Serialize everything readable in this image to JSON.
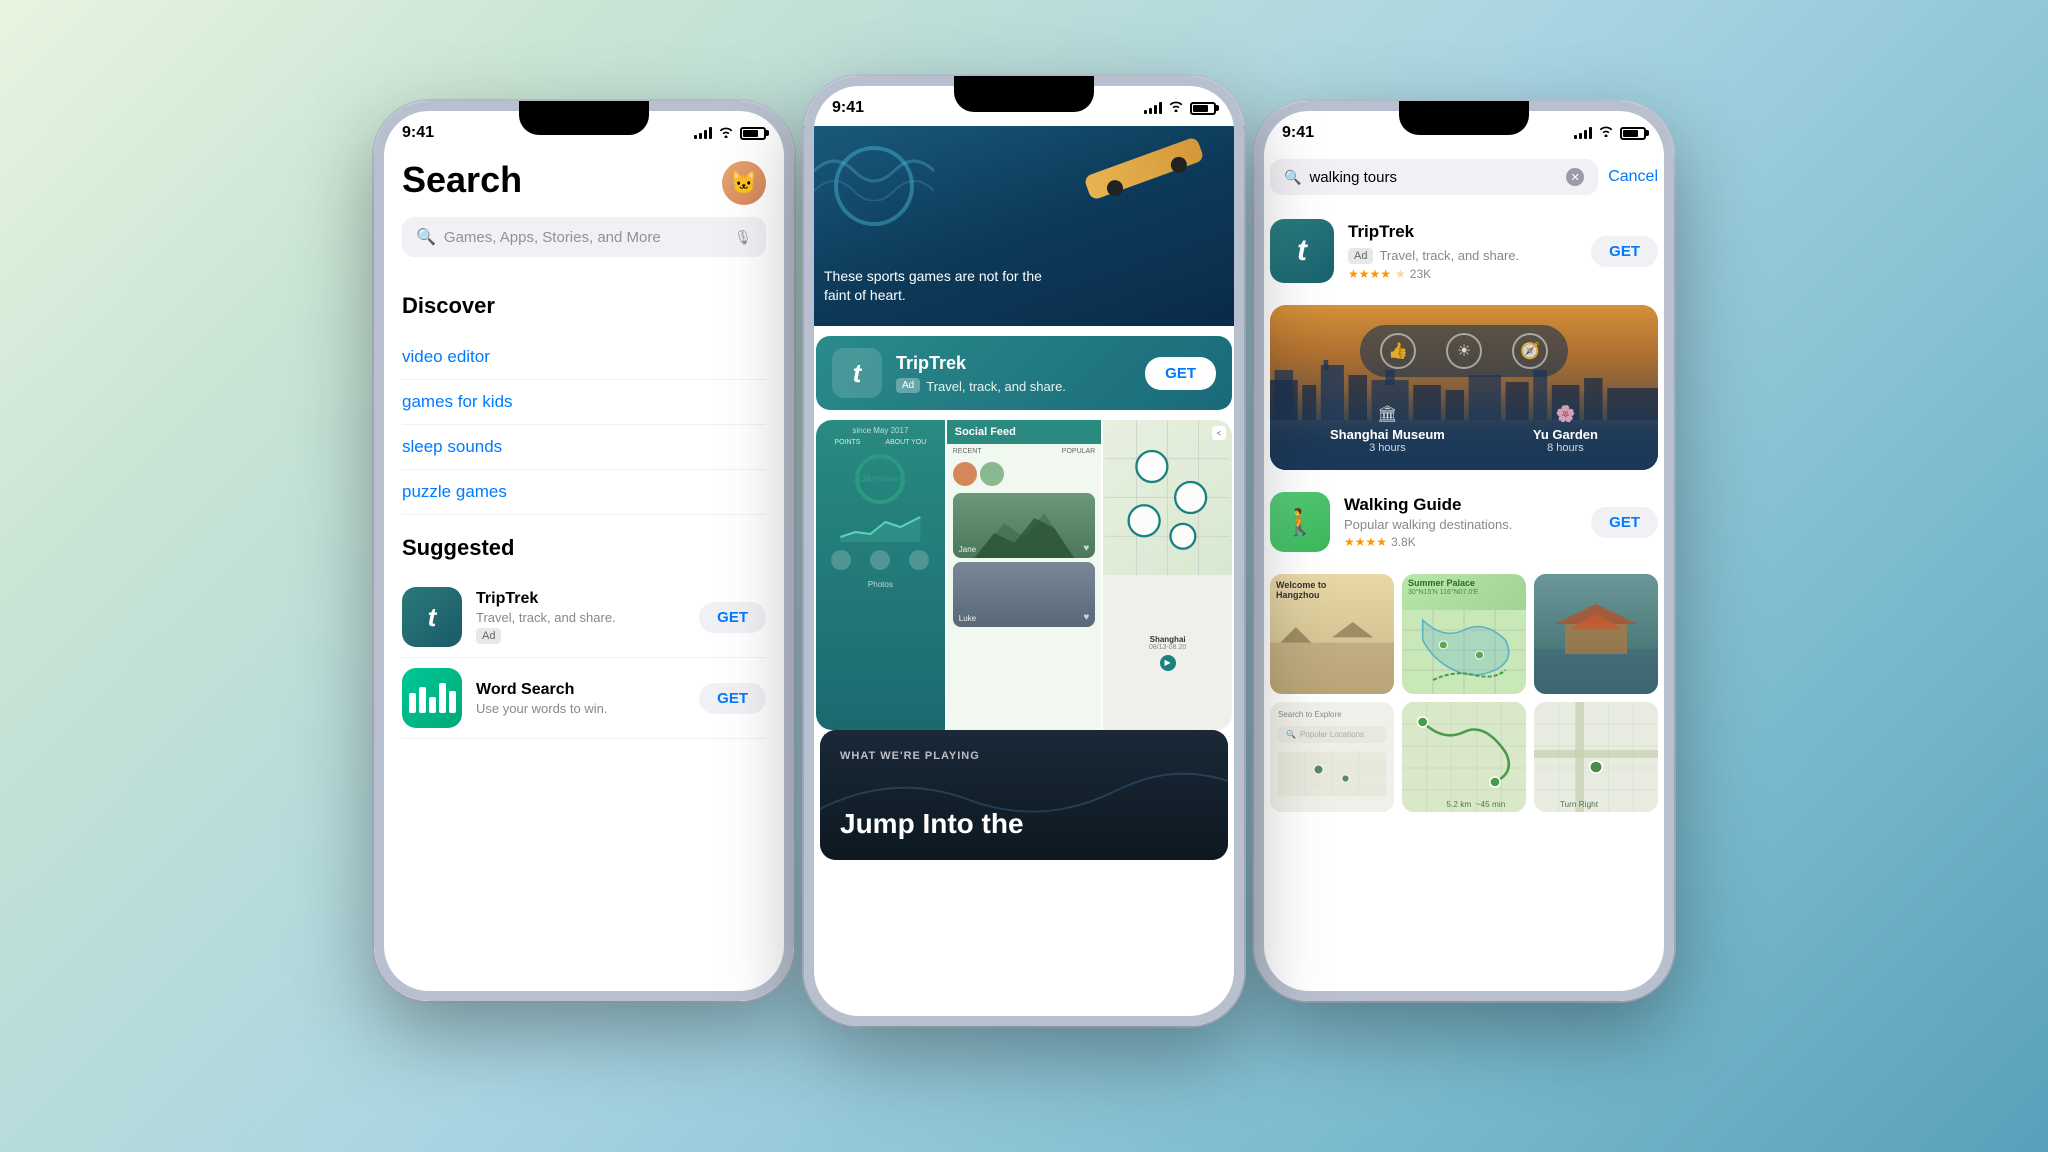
{
  "phones": {
    "left": {
      "time": "9:41",
      "title": "Search",
      "searchPlaceholder": "Games, Apps, Stories, and More",
      "discoverTitle": "Discover",
      "discoverItems": [
        "video editor",
        "games for kids",
        "sleep sounds",
        "puzzle games"
      ],
      "suggestedTitle": "Suggested",
      "apps": [
        {
          "name": "TripTrek",
          "desc": "Travel, track, and share.",
          "ad": true,
          "adLabel": "Ad",
          "btnLabel": "GET"
        },
        {
          "name": "Word Search",
          "desc": "Use your words to win.",
          "ad": false,
          "btnLabel": "GET"
        }
      ]
    },
    "center": {
      "time": "9:41",
      "heroBannerText": "These sports games are not for the faint of heart.",
      "appCard": {
        "name": "TripTrek",
        "adLabel": "Ad",
        "desc": "Travel, track, and share.",
        "btnLabel": "GET"
      },
      "whatWeArePlaying": "WHAT WE'RE PLAYING",
      "jumpTitle": "Jump Into the"
    },
    "right": {
      "time": "9:41",
      "searchValue": "walking tours",
      "cancelLabel": "Cancel",
      "results": [
        {
          "name": "TripTrek",
          "desc": "Travel, track, and share.",
          "adLabel": "Ad",
          "stars": 4.5,
          "reviewCount": "23K",
          "btnLabel": "GET"
        },
        {
          "name": "Walking Guide",
          "desc": "Popular walking destinations.",
          "stars": 4.0,
          "reviewCount": "3.8K",
          "btnLabel": "GET"
        }
      ],
      "featuredPlaces": [
        {
          "name": "Shanghai Museum",
          "hours": "3 hours"
        },
        {
          "name": "Yu Garden",
          "hours": "8 hours"
        }
      ],
      "summerPalace": "Summer Palace"
    }
  }
}
